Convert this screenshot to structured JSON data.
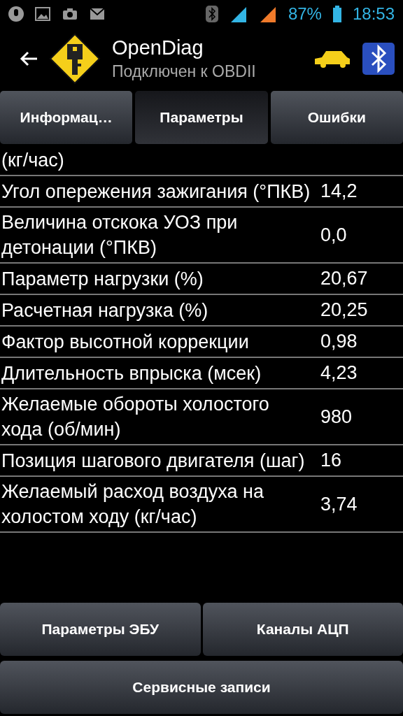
{
  "status_bar": {
    "battery": "87%",
    "time": "18:53"
  },
  "action_bar": {
    "title": "OpenDiag",
    "subtitle": "Подключен к OBDII"
  },
  "tabs": [
    {
      "label": "Информац…",
      "selected": false
    },
    {
      "label": "Параметры",
      "selected": true
    },
    {
      "label": "Ошибки",
      "selected": false
    }
  ],
  "parameters": [
    {
      "name": "(кг/час)"
    },
    {
      "name": "Угол опережения зажигания (°ПКВ)",
      "value": "14,2"
    },
    {
      "name": "Величина отскока УОЗ при детонации (°ПКВ)",
      "value": "0,0"
    },
    {
      "name": "Параметр нагрузки (%)",
      "value": "20,67"
    },
    {
      "name": "Расчетная нагрузка (%)",
      "value": "20,25"
    },
    {
      "name": "Фактор высотной коррекции",
      "value": "0,98"
    },
    {
      "name": "Длительность впрыска (мсек)",
      "value": "4,23"
    },
    {
      "name": "Желаемые обороты холостого хода (об/мин)",
      "value": "980"
    },
    {
      "name": "Позиция шагового двигателя (шаг)",
      "value": "16"
    },
    {
      "name": "Желаемый расход воздуха на холостом ходу (кг/час)",
      "value": "3,74"
    }
  ],
  "buttons": [
    {
      "label": "Параметры ЭБУ"
    },
    {
      "label": "Каналы АЦП"
    },
    {
      "label": "Сервисные записи"
    }
  ]
}
